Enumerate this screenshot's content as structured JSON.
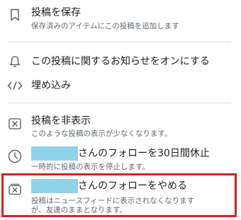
{
  "menu": {
    "save": {
      "icon": "bookmark-icon",
      "title": "投稿を保存",
      "subtitle": "保存済みのアイテムにこの投稿を追加します"
    },
    "notifications": {
      "icon": "bell-icon",
      "title": "この投稿に関するお知らせをオンにする"
    },
    "embed": {
      "icon": "code-icon",
      "title": "埋め込み"
    },
    "hide": {
      "icon": "hide-box-icon",
      "title": "投稿を非表示",
      "subtitle": "このような投稿の表示が少なくなります。"
    },
    "snooze": {
      "icon": "clock-icon",
      "title_suffix": "さんのフォローを30日間休止",
      "subtitle": "一時的に投稿の表示を停止します。"
    },
    "unfollow": {
      "icon": "unfollow-box-icon",
      "title_suffix": "さんのフォローをやめる",
      "subtitle_line1": "投稿はニュースフィードに表示されなくなります",
      "subtitle_line2": "が、友達のままとなります。"
    }
  },
  "colors": {
    "highlight_border": "#d9201f",
    "redaction": "#8fd3e8",
    "text": "#1c1e21",
    "subtext": "#606770",
    "divider": "#dadde1"
  }
}
